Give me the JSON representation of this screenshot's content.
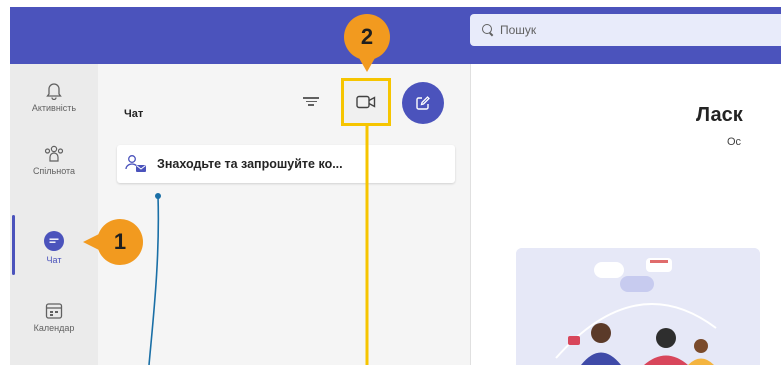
{
  "search": {
    "placeholder": "Пошук"
  },
  "rail": {
    "items": [
      {
        "label": "Активність",
        "icon": "bell-icon"
      },
      {
        "label": "Спільнота",
        "icon": "community-icon"
      },
      {
        "label": "Чат",
        "icon": "chat-icon",
        "active": true
      },
      {
        "label": "Календар",
        "icon": "calendar-icon"
      }
    ]
  },
  "chat": {
    "title": "Чат",
    "invite_label": "Знаходьте та запрошуйте ко..."
  },
  "main": {
    "welcome": "Ласк",
    "subtitle": "Ос"
  },
  "annotations": {
    "badge1": "1",
    "badge2": "2"
  },
  "colors": {
    "brand": "#4b53bc",
    "highlight": "#f6c500",
    "badge": "#f29a1f",
    "callout_line": "#1a6fa6"
  }
}
